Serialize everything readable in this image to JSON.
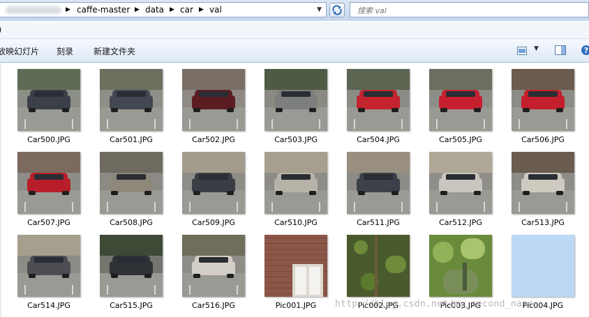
{
  "address_bar": {
    "path": [
      "caffe-master",
      "data",
      "car",
      "val"
    ]
  },
  "search": {
    "placeholder": "搜索 val"
  },
  "menu": {
    "first": ")"
  },
  "toolbar": {
    "slideshow": "放映幻灯片",
    "burn": "刻录",
    "new_folder": "新建文件夹"
  },
  "files": [
    {
      "name": "Car500.JPG",
      "bg": "#8c8f86",
      "sky": "#5f6b55",
      "car": "#3b3f48"
    },
    {
      "name": "Car501.JPG",
      "bg": "#8d8f88",
      "sky": "#6c705e",
      "car": "#444853"
    },
    {
      "name": "Car502.JPG",
      "bg": "#8f8a84",
      "sky": "#7a6e67",
      "car": "#5b1d22"
    },
    {
      "name": "Car503.JPG",
      "bg": "#8a8a82",
      "sky": "#4f5a45",
      "car": "#7d7f7e"
    },
    {
      "name": "Car504.JPG",
      "bg": "#8b8c86",
      "sky": "#5c6551",
      "car": "#c3242e"
    },
    {
      "name": "Car505.JPG",
      "bg": "#8e8e88",
      "sky": "#6a6f5f",
      "car": "#c62030"
    },
    {
      "name": "Car506.JPG",
      "bg": "#8c8c86",
      "sky": "#6b5a4e",
      "car": "#c41f2c"
    },
    {
      "name": "Car507.JPG",
      "bg": "#8d8c86",
      "sky": "#7c6a5e",
      "car": "#b81e2a"
    },
    {
      "name": "Car508.JPG",
      "bg": "#8b8a84",
      "sky": "#6f6a60",
      "car": "#8d887a"
    },
    {
      "name": "Car509.JPG",
      "bg": "#8f8d87",
      "sky": "#a39b8c",
      "car": "#3a3d44"
    },
    {
      "name": "Car510.JPG",
      "bg": "#8e8c86",
      "sky": "#a69f8f",
      "car": "#b8b3a8"
    },
    {
      "name": "Car511.JPG",
      "bg": "#8c8b85",
      "sky": "#998f80",
      "car": "#3c4048"
    },
    {
      "name": "Car512.JPG",
      "bg": "#8f8e88",
      "sky": "#b0a897",
      "car": "#c9c6bf"
    },
    {
      "name": "Car513.JPG",
      "bg": "#8d8c87",
      "sky": "#6a5c4f",
      "car": "#cfcac0"
    },
    {
      "name": "Car514.JPG",
      "bg": "#8c8b85",
      "sky": "#a79f8e",
      "car": "#4b4d52"
    },
    {
      "name": "Car515.JPG",
      "bg": "#74756f",
      "sky": "#3e4a36",
      "car": "#2e3136"
    },
    {
      "name": "Car516.JPG",
      "bg": "#8e8d87",
      "sky": "#6f6d5c",
      "car": "#d3cfc6"
    },
    {
      "name": "Pic001.JPG",
      "bg": "#8c5648",
      "sky": "#9e6555",
      "car": "#ddd8d0"
    },
    {
      "name": "Pic002.JPG",
      "bg": "#4a5a2c",
      "sky": "#6f8a3a",
      "car": "#3a4a22"
    },
    {
      "name": "Pic003.JPG",
      "bg": "#6a8a3c",
      "sky": "#92b25a",
      "car": "#7a8e5a"
    },
    {
      "name": "Pic004.JPG",
      "bg": "#bcd8f5",
      "sky": "#bcd8f5",
      "car": "#bcd8f5"
    }
  ],
  "watermark": "http://blog.csdn.net/my_second_name"
}
